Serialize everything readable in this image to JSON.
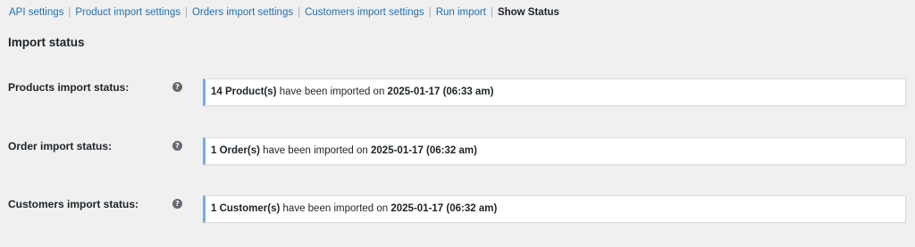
{
  "nav": {
    "items": [
      {
        "label": "API settings"
      },
      {
        "label": "Product import settings"
      },
      {
        "label": "Orders import settings"
      },
      {
        "label": "Customers import settings"
      },
      {
        "label": "Run import"
      }
    ],
    "separator": "|",
    "current": "Show Status"
  },
  "section": {
    "title": "Import status"
  },
  "help_icon": "question-circle-icon",
  "accent_color": "#72aee6",
  "link_color": "#2271b1",
  "rows": [
    {
      "label": "Products import status:",
      "count": "14 Product(s)",
      "middle": "have been imported on",
      "datetime": "2025-01-17 (06:33 am)"
    },
    {
      "label": "Order import status:",
      "count": "1 Order(s)",
      "middle": "have been imported on",
      "datetime": "2025-01-17 (06:32 am)"
    },
    {
      "label": "Customers import status:",
      "count": "1 Customer(s)",
      "middle": "have been imported on",
      "datetime": "2025-01-17 (06:32 am)"
    }
  ]
}
